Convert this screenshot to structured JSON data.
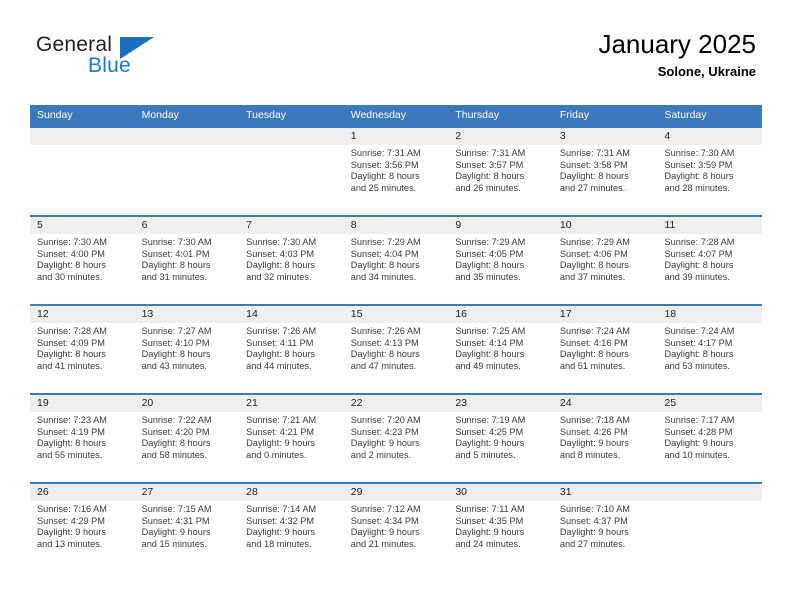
{
  "brand": {
    "name_part1": "General",
    "name_part2": "Blue",
    "triangle_icon": "triangle-icon"
  },
  "header": {
    "month_title": "January 2025",
    "location": "Solone, Ukraine"
  },
  "colors": {
    "header_blue": "#3b79bd",
    "day_band_gray": "#efefef",
    "brand_blue": "#1f7ac4",
    "text_dark": "#231f20"
  },
  "weekdays": [
    "Sunday",
    "Monday",
    "Tuesday",
    "Wednesday",
    "Thursday",
    "Friday",
    "Saturday"
  ],
  "weeks": [
    [
      {
        "day": "",
        "empty": true,
        "sunrise": "",
        "sunset": "",
        "daylight_line1": "",
        "daylight_line2": ""
      },
      {
        "day": "",
        "empty": true,
        "sunrise": "",
        "sunset": "",
        "daylight_line1": "",
        "daylight_line2": ""
      },
      {
        "day": "",
        "empty": true,
        "sunrise": "",
        "sunset": "",
        "daylight_line1": "",
        "daylight_line2": ""
      },
      {
        "day": "1",
        "empty": false,
        "sunrise": "Sunrise: 7:31 AM",
        "sunset": "Sunset: 3:56 PM",
        "daylight_line1": "Daylight: 8 hours",
        "daylight_line2": "and 25 minutes."
      },
      {
        "day": "2",
        "empty": false,
        "sunrise": "Sunrise: 7:31 AM",
        "sunset": "Sunset: 3:57 PM",
        "daylight_line1": "Daylight: 8 hours",
        "daylight_line2": "and 26 minutes."
      },
      {
        "day": "3",
        "empty": false,
        "sunrise": "Sunrise: 7:31 AM",
        "sunset": "Sunset: 3:58 PM",
        "daylight_line1": "Daylight: 8 hours",
        "daylight_line2": "and 27 minutes."
      },
      {
        "day": "4",
        "empty": false,
        "sunrise": "Sunrise: 7:30 AM",
        "sunset": "Sunset: 3:59 PM",
        "daylight_line1": "Daylight: 8 hours",
        "daylight_line2": "and 28 minutes."
      }
    ],
    [
      {
        "day": "5",
        "empty": false,
        "sunrise": "Sunrise: 7:30 AM",
        "sunset": "Sunset: 4:00 PM",
        "daylight_line1": "Daylight: 8 hours",
        "daylight_line2": "and 30 minutes."
      },
      {
        "day": "6",
        "empty": false,
        "sunrise": "Sunrise: 7:30 AM",
        "sunset": "Sunset: 4:01 PM",
        "daylight_line1": "Daylight: 8 hours",
        "daylight_line2": "and 31 minutes."
      },
      {
        "day": "7",
        "empty": false,
        "sunrise": "Sunrise: 7:30 AM",
        "sunset": "Sunset: 4:03 PM",
        "daylight_line1": "Daylight: 8 hours",
        "daylight_line2": "and 32 minutes."
      },
      {
        "day": "8",
        "empty": false,
        "sunrise": "Sunrise: 7:29 AM",
        "sunset": "Sunset: 4:04 PM",
        "daylight_line1": "Daylight: 8 hours",
        "daylight_line2": "and 34 minutes."
      },
      {
        "day": "9",
        "empty": false,
        "sunrise": "Sunrise: 7:29 AM",
        "sunset": "Sunset: 4:05 PM",
        "daylight_line1": "Daylight: 8 hours",
        "daylight_line2": "and 35 minutes."
      },
      {
        "day": "10",
        "empty": false,
        "sunrise": "Sunrise: 7:29 AM",
        "sunset": "Sunset: 4:06 PM",
        "daylight_line1": "Daylight: 8 hours",
        "daylight_line2": "and 37 minutes."
      },
      {
        "day": "11",
        "empty": false,
        "sunrise": "Sunrise: 7:28 AM",
        "sunset": "Sunset: 4:07 PM",
        "daylight_line1": "Daylight: 8 hours",
        "daylight_line2": "and 39 minutes."
      }
    ],
    [
      {
        "day": "12",
        "empty": false,
        "sunrise": "Sunrise: 7:28 AM",
        "sunset": "Sunset: 4:09 PM",
        "daylight_line1": "Daylight: 8 hours",
        "daylight_line2": "and 41 minutes."
      },
      {
        "day": "13",
        "empty": false,
        "sunrise": "Sunrise: 7:27 AM",
        "sunset": "Sunset: 4:10 PM",
        "daylight_line1": "Daylight: 8 hours",
        "daylight_line2": "and 43 minutes."
      },
      {
        "day": "14",
        "empty": false,
        "sunrise": "Sunrise: 7:26 AM",
        "sunset": "Sunset: 4:11 PM",
        "daylight_line1": "Daylight: 8 hours",
        "daylight_line2": "and 44 minutes."
      },
      {
        "day": "15",
        "empty": false,
        "sunrise": "Sunrise: 7:26 AM",
        "sunset": "Sunset: 4:13 PM",
        "daylight_line1": "Daylight: 8 hours",
        "daylight_line2": "and 47 minutes."
      },
      {
        "day": "16",
        "empty": false,
        "sunrise": "Sunrise: 7:25 AM",
        "sunset": "Sunset: 4:14 PM",
        "daylight_line1": "Daylight: 8 hours",
        "daylight_line2": "and 49 minutes."
      },
      {
        "day": "17",
        "empty": false,
        "sunrise": "Sunrise: 7:24 AM",
        "sunset": "Sunset: 4:16 PM",
        "daylight_line1": "Daylight: 8 hours",
        "daylight_line2": "and 51 minutes."
      },
      {
        "day": "18",
        "empty": false,
        "sunrise": "Sunrise: 7:24 AM",
        "sunset": "Sunset: 4:17 PM",
        "daylight_line1": "Daylight: 8 hours",
        "daylight_line2": "and 53 minutes."
      }
    ],
    [
      {
        "day": "19",
        "empty": false,
        "sunrise": "Sunrise: 7:23 AM",
        "sunset": "Sunset: 4:19 PM",
        "daylight_line1": "Daylight: 8 hours",
        "daylight_line2": "and 55 minutes."
      },
      {
        "day": "20",
        "empty": false,
        "sunrise": "Sunrise: 7:22 AM",
        "sunset": "Sunset: 4:20 PM",
        "daylight_line1": "Daylight: 8 hours",
        "daylight_line2": "and 58 minutes."
      },
      {
        "day": "21",
        "empty": false,
        "sunrise": "Sunrise: 7:21 AM",
        "sunset": "Sunset: 4:21 PM",
        "daylight_line1": "Daylight: 9 hours",
        "daylight_line2": "and 0 minutes."
      },
      {
        "day": "22",
        "empty": false,
        "sunrise": "Sunrise: 7:20 AM",
        "sunset": "Sunset: 4:23 PM",
        "daylight_line1": "Daylight: 9 hours",
        "daylight_line2": "and 2 minutes."
      },
      {
        "day": "23",
        "empty": false,
        "sunrise": "Sunrise: 7:19 AM",
        "sunset": "Sunset: 4:25 PM",
        "daylight_line1": "Daylight: 9 hours",
        "daylight_line2": "and 5 minutes."
      },
      {
        "day": "24",
        "empty": false,
        "sunrise": "Sunrise: 7:18 AM",
        "sunset": "Sunset: 4:26 PM",
        "daylight_line1": "Daylight: 9 hours",
        "daylight_line2": "and 8 minutes."
      },
      {
        "day": "25",
        "empty": false,
        "sunrise": "Sunrise: 7:17 AM",
        "sunset": "Sunset: 4:28 PM",
        "daylight_line1": "Daylight: 9 hours",
        "daylight_line2": "and 10 minutes."
      }
    ],
    [
      {
        "day": "26",
        "empty": false,
        "sunrise": "Sunrise: 7:16 AM",
        "sunset": "Sunset: 4:29 PM",
        "daylight_line1": "Daylight: 9 hours",
        "daylight_line2": "and 13 minutes."
      },
      {
        "day": "27",
        "empty": false,
        "sunrise": "Sunrise: 7:15 AM",
        "sunset": "Sunset: 4:31 PM",
        "daylight_line1": "Daylight: 9 hours",
        "daylight_line2": "and 15 minutes."
      },
      {
        "day": "28",
        "empty": false,
        "sunrise": "Sunrise: 7:14 AM",
        "sunset": "Sunset: 4:32 PM",
        "daylight_line1": "Daylight: 9 hours",
        "daylight_line2": "and 18 minutes."
      },
      {
        "day": "29",
        "empty": false,
        "sunrise": "Sunrise: 7:12 AM",
        "sunset": "Sunset: 4:34 PM",
        "daylight_line1": "Daylight: 9 hours",
        "daylight_line2": "and 21 minutes."
      },
      {
        "day": "30",
        "empty": false,
        "sunrise": "Sunrise: 7:11 AM",
        "sunset": "Sunset: 4:35 PM",
        "daylight_line1": "Daylight: 9 hours",
        "daylight_line2": "and 24 minutes."
      },
      {
        "day": "31",
        "empty": false,
        "sunrise": "Sunrise: 7:10 AM",
        "sunset": "Sunset: 4:37 PM",
        "daylight_line1": "Daylight: 9 hours",
        "daylight_line2": "and 27 minutes."
      },
      {
        "day": "",
        "empty": true,
        "sunrise": "",
        "sunset": "",
        "daylight_line1": "",
        "daylight_line2": ""
      }
    ]
  ]
}
